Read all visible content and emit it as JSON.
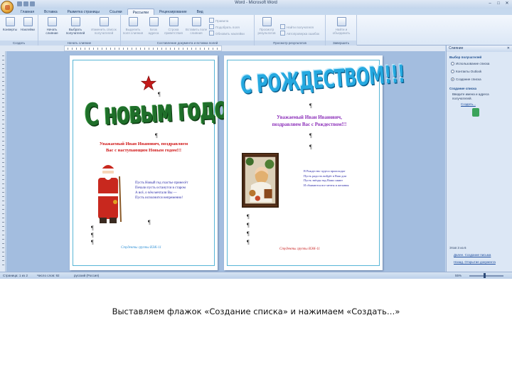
{
  "window": {
    "title": "Word - Microsoft Word",
    "controls": [
      "–",
      "□",
      "✕"
    ]
  },
  "tabs": [
    {
      "label": "Главная",
      "active": false
    },
    {
      "label": "Вставка",
      "active": false
    },
    {
      "label": "Разметка страницы",
      "active": false
    },
    {
      "label": "Ссылки",
      "active": false
    },
    {
      "label": "Рассылки",
      "active": true
    },
    {
      "label": "Рецензирование",
      "active": false
    },
    {
      "label": "Вид",
      "active": false
    }
  ],
  "ribbon": {
    "groups": [
      {
        "label": "Создать",
        "buttons": [
          "Конверты",
          "Наклейки"
        ]
      },
      {
        "label": "Начать слияние",
        "buttons": [
          "Начать слияние",
          "Выбрать получателей",
          "Изменить список получателей"
        ]
      },
      {
        "label": "Составление документа и вставка полей",
        "buttons": [
          "Выделить поля слияния",
          "Блок адреса",
          "Строка приветствия",
          "Вставить поле слияния"
        ],
        "small": [
          "Правила",
          "Подобрать поля",
          "Обновить наклейки"
        ]
      },
      {
        "label": "Просмотр результатов",
        "buttons": [
          "Просмотр результатов"
        ],
        "small": [
          "Найти получателя",
          "Автопроверка ошибок"
        ]
      },
      {
        "label": "Завершить",
        "buttons": [
          "Найти и объединить"
        ]
      }
    ]
  },
  "page1": {
    "title": "С новым годом",
    "greeting": [
      "Уважаемый Иван Иванович, поздравляем",
      "Вас с наступающим Новым годом!!!"
    ],
    "poem": [
      "Пусть Новый год счастье принесёт",
      "Печали пусть останутся в старом",
      "А всё, о чём мечтали Вы —",
      "Пусть исполнится непременно!"
    ],
    "signature": "Студенты группы ВЭК-11"
  },
  "page2": {
    "title": "С РОЖДЕСТВОМ!!!",
    "greeting": [
      "Уважаемый Иван Иванович,",
      "поздравляем Вас с Рождеством!!!"
    ],
    "poem": [
      "В Рождество чудеса происходят",
      "Пусть радость войдёт в Ваш дом",
      "Пусть звёзды над Вами сияют",
      "И сбываются все мечты и желания"
    ],
    "signature": "Студенты группы ВЭК-11"
  },
  "taskpane": {
    "header": "Слияние",
    "section1_title": "Выбор получателей",
    "options": [
      {
        "label": "Использование списка",
        "selected": false
      },
      {
        "label": "Контакты Outlook",
        "selected": false
      },
      {
        "label": "Создание списка",
        "selected": true
      }
    ],
    "section2_title": "Создание списка",
    "section2_text": [
      "Введите имена и адреса",
      "получателей."
    ],
    "create_link": "Создать...",
    "step_text": "Этап 3 из 6",
    "next_link": "Далее. Создание письма",
    "prev_link": "Назад. Открытие документа"
  },
  "statusbar": {
    "page": "Страница: 1 из 2",
    "words": "Число слов: 92",
    "language": "русский (Россия)",
    "zoom": "55%"
  },
  "caption": "Выставляем флажок «Создание списка» и нажимаем «Создать…»"
}
